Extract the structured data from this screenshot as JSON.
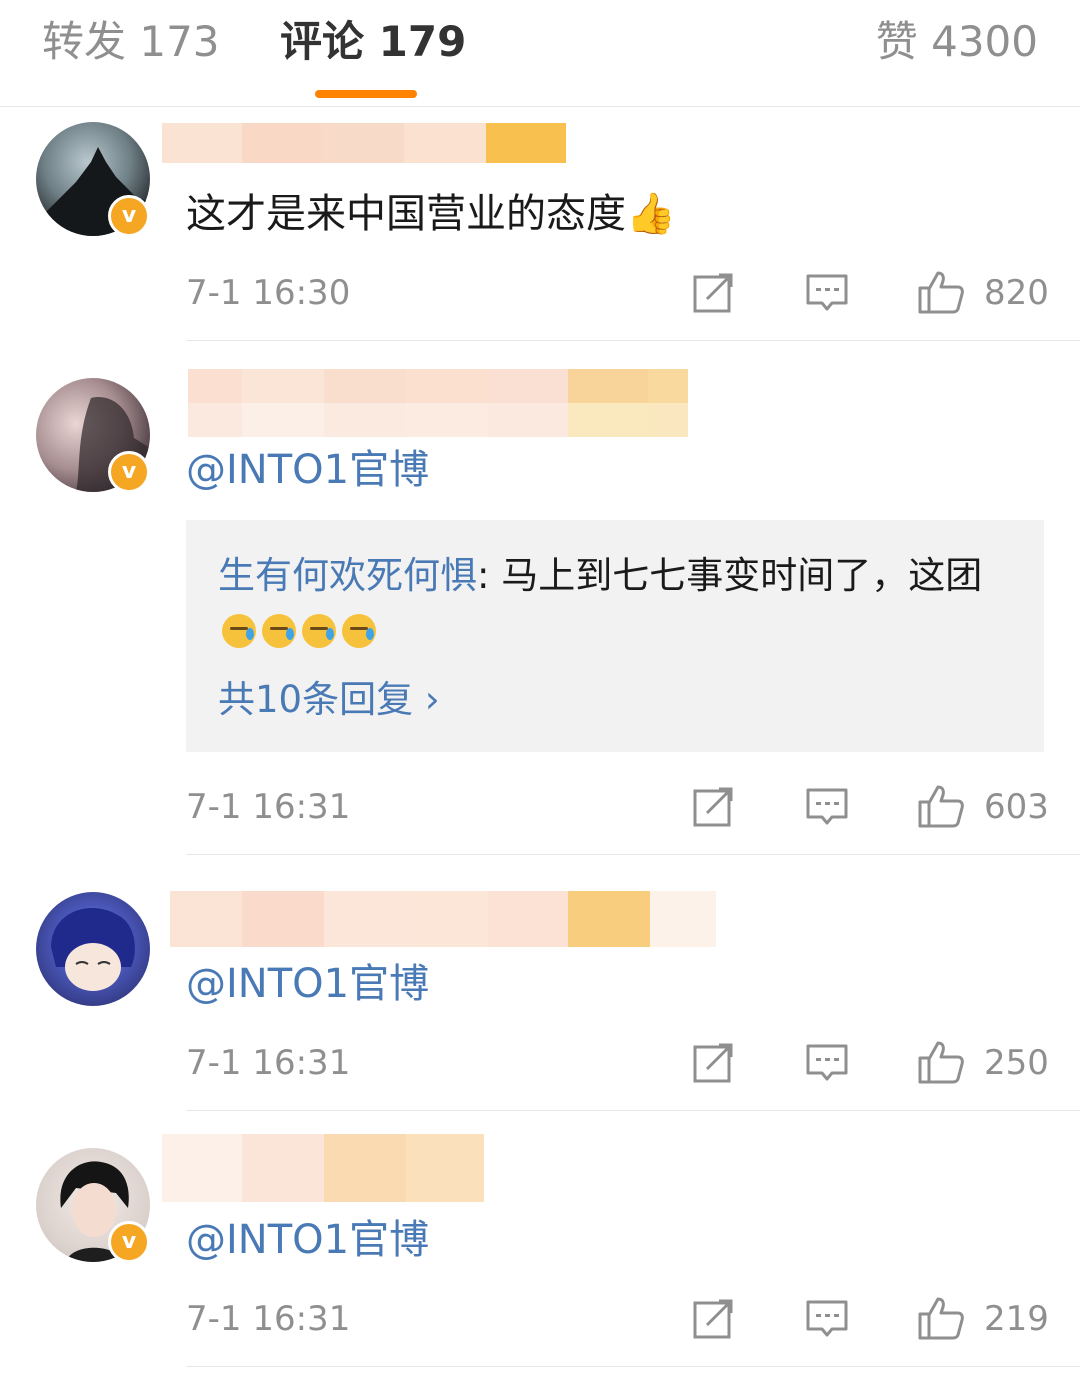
{
  "tabs": {
    "repost": "转发 173",
    "comments": "评论 179",
    "likes": "赞 4300"
  },
  "colors": {
    "accent": "#ff8200",
    "link": "#4a7ab5",
    "verified_badge": "#f5a623"
  },
  "icons": [
    "share-icon",
    "reply-icon",
    "like-icon",
    "verified-badge-icon"
  ],
  "comments": [
    {
      "text": "这才是来中国营业的态度",
      "emoji": "👍",
      "time": "7-1 16:30",
      "likes": "820",
      "verified": true
    },
    {
      "text": "@INTO1官博",
      "time": "7-1 16:31",
      "likes": "603",
      "verified": true,
      "reply_preview": {
        "author": "生有何欢死何惧",
        "separator": ":",
        "text": " 马上到七七事变时间了，这团",
        "more": "共10条回复 ›"
      }
    },
    {
      "text": "@INTO1官博",
      "time": "7-1 16:31",
      "likes": "250",
      "verified": false
    },
    {
      "text": "@INTO1官博",
      "time": "7-1 16:31",
      "likes": "219",
      "verified": true
    }
  ]
}
